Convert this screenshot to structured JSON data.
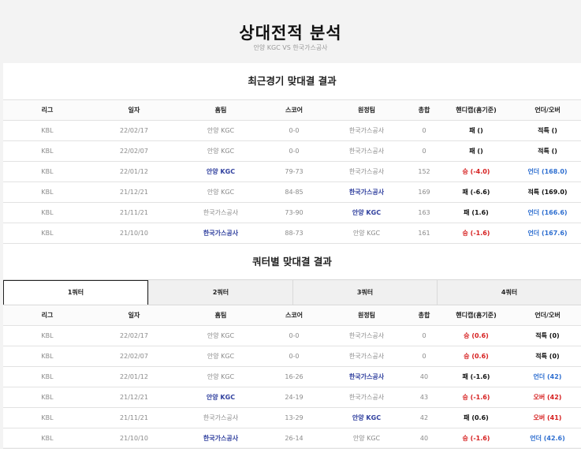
{
  "header": {
    "title": "상대전적 분석",
    "subtitle": "안양 KGC VS 한국가스공사"
  },
  "recent": {
    "section_title": "최근경기 맞대결 결과",
    "columns": [
      "리그",
      "일자",
      "홈팀",
      "스코어",
      "원정팀",
      "총합",
      "핸디캡(홈기준)",
      "언더/오버"
    ],
    "rows": [
      {
        "league": "KBL",
        "date": "22/02/17",
        "home": "안양 KGC",
        "score": "0-0",
        "away": "한국가스공사",
        "total": "0",
        "handicap": "패 ()",
        "handicap_color": "black",
        "ou": "적특 ()",
        "ou_color": "black",
        "winner": "none"
      },
      {
        "league": "KBL",
        "date": "22/02/07",
        "home": "안양 KGC",
        "score": "0-0",
        "away": "한국가스공사",
        "total": "0",
        "handicap": "패 ()",
        "handicap_color": "black",
        "ou": "적특 ()",
        "ou_color": "black",
        "winner": "none"
      },
      {
        "league": "KBL",
        "date": "22/01/12",
        "home": "안양 KGC",
        "score": "79-73",
        "away": "한국가스공사",
        "total": "152",
        "handicap": "승 (-4.0)",
        "handicap_color": "red",
        "ou": "언더 (168.0)",
        "ou_color": "blue",
        "winner": "home"
      },
      {
        "league": "KBL",
        "date": "21/12/21",
        "home": "안양 KGC",
        "score": "84-85",
        "away": "한국가스공사",
        "total": "169",
        "handicap": "패 (-6.6)",
        "handicap_color": "black",
        "ou": "적특 (169.0)",
        "ou_color": "black",
        "winner": "away"
      },
      {
        "league": "KBL",
        "date": "21/11/21",
        "home": "한국가스공사",
        "score": "73-90",
        "away": "안양 KGC",
        "total": "163",
        "handicap": "패 (1.6)",
        "handicap_color": "black",
        "ou": "언더 (166.6)",
        "ou_color": "blue",
        "winner": "away"
      },
      {
        "league": "KBL",
        "date": "21/10/10",
        "home": "한국가스공사",
        "score": "88-73",
        "away": "안양 KGC",
        "total": "161",
        "handicap": "승 (-1.6)",
        "handicap_color": "red",
        "ou": "언더 (167.6)",
        "ou_color": "blue",
        "winner": "home"
      }
    ]
  },
  "quarter": {
    "section_title": "쿼터별 맞대결 결과",
    "tabs": [
      "1쿼터",
      "2쿼터",
      "3쿼터",
      "4쿼터"
    ],
    "active_tab": 0,
    "columns": [
      "리그",
      "일자",
      "홈팀",
      "스코어",
      "원정팀",
      "총합",
      "핸디캡(홈기준)",
      "언더/오버"
    ],
    "rows": [
      {
        "league": "KBL",
        "date": "22/02/17",
        "home": "안양 KGC",
        "score": "0-0",
        "away": "한국가스공사",
        "total": "0",
        "handicap": "승 (0.6)",
        "handicap_color": "red",
        "ou": "적특 (0)",
        "ou_color": "black",
        "winner": "none"
      },
      {
        "league": "KBL",
        "date": "22/02/07",
        "home": "안양 KGC",
        "score": "0-0",
        "away": "한국가스공사",
        "total": "0",
        "handicap": "승 (0.6)",
        "handicap_color": "red",
        "ou": "적특 (0)",
        "ou_color": "black",
        "winner": "none"
      },
      {
        "league": "KBL",
        "date": "22/01/12",
        "home": "안양 KGC",
        "score": "16-26",
        "away": "한국가스공사",
        "total": "40",
        "handicap": "패 (-1.6)",
        "handicap_color": "black",
        "ou": "언더 (42)",
        "ou_color": "blue",
        "winner": "away"
      },
      {
        "league": "KBL",
        "date": "21/12/21",
        "home": "안양 KGC",
        "score": "24-19",
        "away": "한국가스공사",
        "total": "43",
        "handicap": "승 (-1.6)",
        "handicap_color": "red",
        "ou": "오버 (42)",
        "ou_color": "red",
        "winner": "home"
      },
      {
        "league": "KBL",
        "date": "21/11/21",
        "home": "한국가스공사",
        "score": "13-29",
        "away": "안양 KGC",
        "total": "42",
        "handicap": "패 (0.6)",
        "handicap_color": "black",
        "ou": "오버 (41)",
        "ou_color": "red",
        "winner": "away"
      },
      {
        "league": "KBL",
        "date": "21/10/10",
        "home": "한국가스공사",
        "score": "26-14",
        "away": "안양 KGC",
        "total": "40",
        "handicap": "승 (-1.6)",
        "handicap_color": "red",
        "ou": "언더 (42.6)",
        "ou_color": "blue",
        "winner": "home"
      }
    ]
  },
  "colors": {
    "winner_team": "#2f3f9e",
    "win_red": "#d61f1f",
    "under_blue": "#2f6fd0"
  }
}
